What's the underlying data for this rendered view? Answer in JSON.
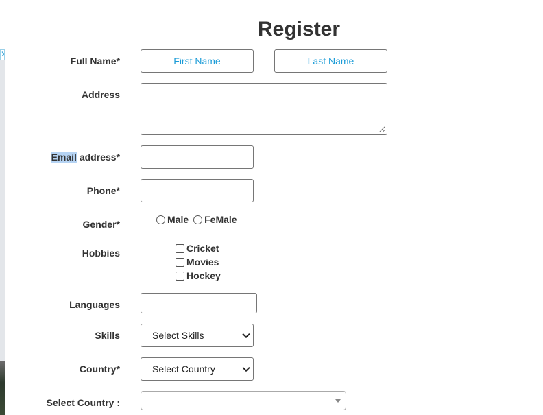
{
  "page": {
    "title": "Register"
  },
  "ad": {
    "close_glyph": "✕"
  },
  "form": {
    "full_name": {
      "label": "Full Name*",
      "first_placeholder": "First Name",
      "last_placeholder": "Last Name"
    },
    "address": {
      "label": "Address",
      "value": ""
    },
    "email": {
      "label_highlight": "Email",
      "label_rest": " address*",
      "value": ""
    },
    "phone": {
      "label": "Phone*",
      "value": ""
    },
    "gender": {
      "label": "Gender*",
      "options": [
        "Male",
        "FeMale"
      ]
    },
    "hobbies": {
      "label": "Hobbies",
      "options": [
        "Cricket",
        "Movies",
        "Hockey"
      ]
    },
    "languages": {
      "label": "Languages",
      "value": ""
    },
    "skills": {
      "label": "Skills",
      "selected": "Select Skills"
    },
    "country": {
      "label": "Country*",
      "selected": "Select Country"
    },
    "select_country": {
      "label": "Select Country :",
      "selected": ""
    }
  },
  "colors": {
    "placeholder": "#1a9bd7",
    "highlight": "#b5d3f3"
  }
}
